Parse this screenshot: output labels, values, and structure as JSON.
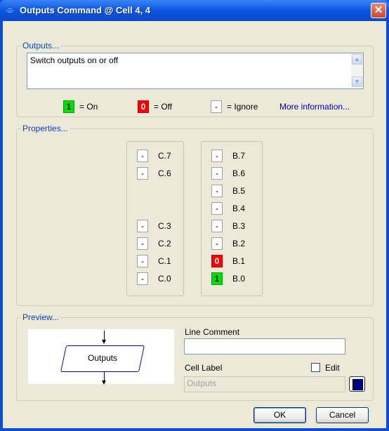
{
  "window": {
    "title": "Outputs Command @ Cell 4, 4",
    "close_glyph": "✕",
    "title_icon_glyph": "⌯"
  },
  "outputs": {
    "group_title": "Outputs...",
    "description": "Switch outputs on or off",
    "legend": {
      "on_value": "1",
      "on_label": "= On",
      "off_value": "0",
      "off_label": "= Off",
      "ignore_value": "-",
      "ignore_label": "= Ignore"
    },
    "more_info_link": "More information..."
  },
  "properties": {
    "group_title": "Properties...",
    "port_c": [
      {
        "label": "C.7",
        "value": "-",
        "state": "ignore"
      },
      {
        "label": "C.6",
        "value": "-",
        "state": "ignore"
      },
      {
        "label": "C.3",
        "value": "-",
        "state": "ignore"
      },
      {
        "label": "C.2",
        "value": "-",
        "state": "ignore"
      },
      {
        "label": "C.1",
        "value": "-",
        "state": "ignore"
      },
      {
        "label": "C.0",
        "value": "-",
        "state": "ignore"
      }
    ],
    "port_b": [
      {
        "label": "B.7",
        "value": "-",
        "state": "ignore"
      },
      {
        "label": "B.6",
        "value": "-",
        "state": "ignore"
      },
      {
        "label": "B.5",
        "value": "-",
        "state": "ignore"
      },
      {
        "label": "B.4",
        "value": "-",
        "state": "ignore"
      },
      {
        "label": "B.3",
        "value": "-",
        "state": "ignore"
      },
      {
        "label": "B.2",
        "value": "-",
        "state": "ignore"
      },
      {
        "label": "B.1",
        "value": "0",
        "state": "off"
      },
      {
        "label": "B.0",
        "value": "1",
        "state": "on"
      }
    ]
  },
  "preview": {
    "group_title": "Preview...",
    "flowchart_label": "Outputs",
    "line_comment_label": "Line Comment",
    "line_comment_value": "",
    "cell_label_label": "Cell Label",
    "cell_label_placeholder": "Outputs",
    "edit_label": "Edit",
    "edit_checked": false,
    "label_color": "#00008b"
  },
  "buttons": {
    "ok": "OK",
    "cancel": "Cancel"
  },
  "colors": {
    "on": "#00e000",
    "off": "#ff0000",
    "link": "#0000cc",
    "group_title": "#0046d5"
  }
}
